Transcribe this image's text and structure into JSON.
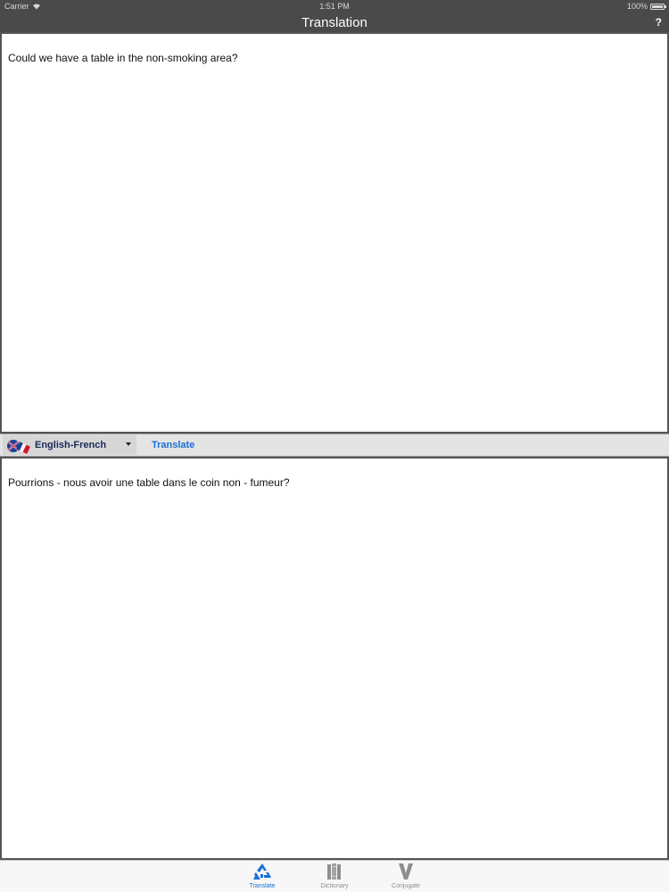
{
  "status_bar": {
    "carrier": "Carrier",
    "time": "1:51 PM",
    "battery": "100%"
  },
  "nav": {
    "title": "Translation",
    "help_label": "?"
  },
  "source": {
    "text": "Could we have a table in the non-smoking area?"
  },
  "toolbar": {
    "language_pair": "English-French",
    "translate_label": "Translate"
  },
  "target": {
    "text": "Pourrions - nous avoir une table dans le coin non - fumeur?"
  },
  "tabs": [
    {
      "label": "Translate",
      "icon": "recycle-icon",
      "active": true
    },
    {
      "label": "Dictionary",
      "icon": "books-icon",
      "active": false
    },
    {
      "label": "Conjugate",
      "icon": "v-letter-icon",
      "active": false
    }
  ],
  "colors": {
    "bar": "#4a4a4a",
    "accent": "#1a6fd6",
    "inactive_tab": "#8e8e8e"
  }
}
